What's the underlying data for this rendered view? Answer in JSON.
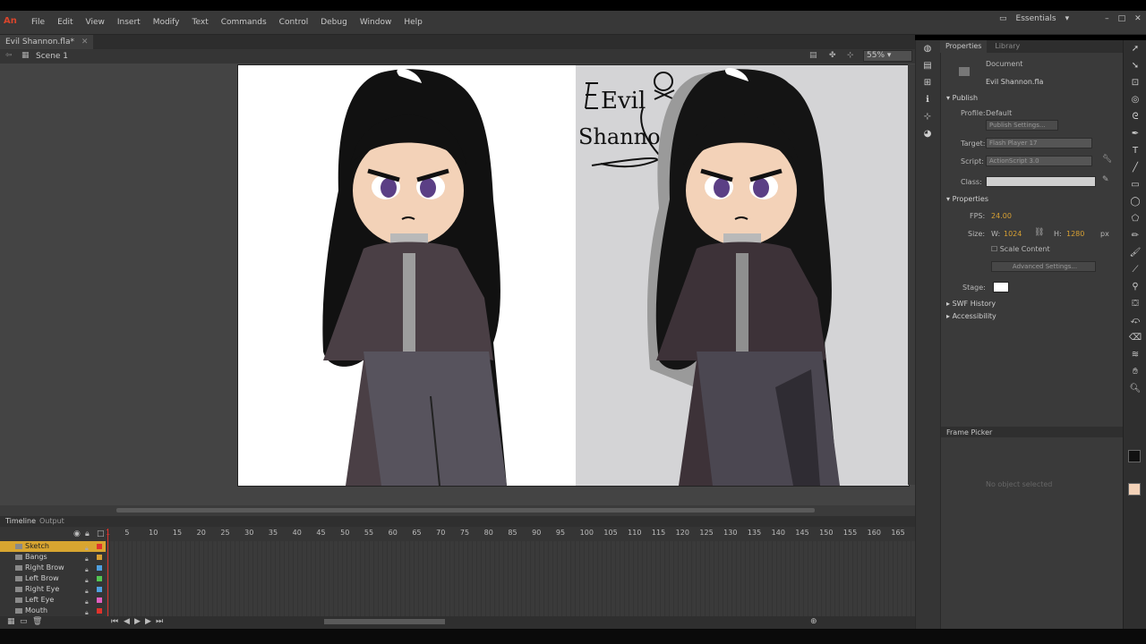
{
  "app": {
    "logo": "An",
    "workspace": "Essentials"
  },
  "menu": [
    "File",
    "Edit",
    "View",
    "Insert",
    "Modify",
    "Text",
    "Commands",
    "Control",
    "Debug",
    "Window",
    "Help"
  ],
  "document": {
    "tab": "Evil Shannon.fla*",
    "scene": "Scene 1",
    "zoom": "55%"
  },
  "stage_text": {
    "title_line1": "Evil",
    "title_line2": "Shannon"
  },
  "timeline": {
    "tabs": [
      "Timeline",
      "Output"
    ],
    "layers": [
      {
        "name": "Sketch",
        "color": "#e0332c",
        "selected": true
      },
      {
        "name": "Bangs",
        "color": "#d7a033",
        "selected": false
      },
      {
        "name": "Right Brow",
        "color": "#4fa0e0",
        "selected": false
      },
      {
        "name": "Left Brow",
        "color": "#53c653",
        "selected": false
      },
      {
        "name": "Right Eye",
        "color": "#4fa0e0",
        "selected": false
      },
      {
        "name": "Left Eye",
        "color": "#e060c0",
        "selected": false
      },
      {
        "name": "Mouth",
        "color": "#e0332c",
        "selected": false
      }
    ],
    "ruler": [
      "1",
      "5",
      "10",
      "15",
      "20",
      "25",
      "30",
      "35",
      "40",
      "45",
      "50",
      "55",
      "60",
      "65",
      "70",
      "75",
      "80",
      "85",
      "90",
      "95",
      "100",
      "105",
      "110",
      "115",
      "120",
      "125",
      "130",
      "135",
      "140",
      "145",
      "150",
      "155",
      "160",
      "165"
    ]
  },
  "properties": {
    "tabs": [
      "Properties",
      "Library"
    ],
    "doc_type": "Document",
    "doc_name": "Evil Shannon.fla",
    "publish_header": "Publish",
    "profile_label": "Profile:",
    "profile_value": "Default",
    "publish_settings": "Publish Settings...",
    "target_label": "Target:",
    "target_value": "Flash Player 17",
    "script_label": "Script:",
    "script_value": "ActionScript 3.0",
    "class_label": "Class:",
    "properties_header": "Properties",
    "fps_label": "FPS:",
    "fps_value": "24.00",
    "size_label": "Size:",
    "w_label": "W:",
    "w_value": "1024",
    "h_label": "H:",
    "h_value": "1280",
    "unit": "px",
    "scale_content": "Scale Content",
    "advanced_settings": "Advanced Settings...",
    "stage_label": "Stage:",
    "swf_history": "SWF History",
    "accessibility": "Accessibility",
    "frame_picker": "Frame Picker",
    "frame_picker_msg": "No object selected"
  }
}
